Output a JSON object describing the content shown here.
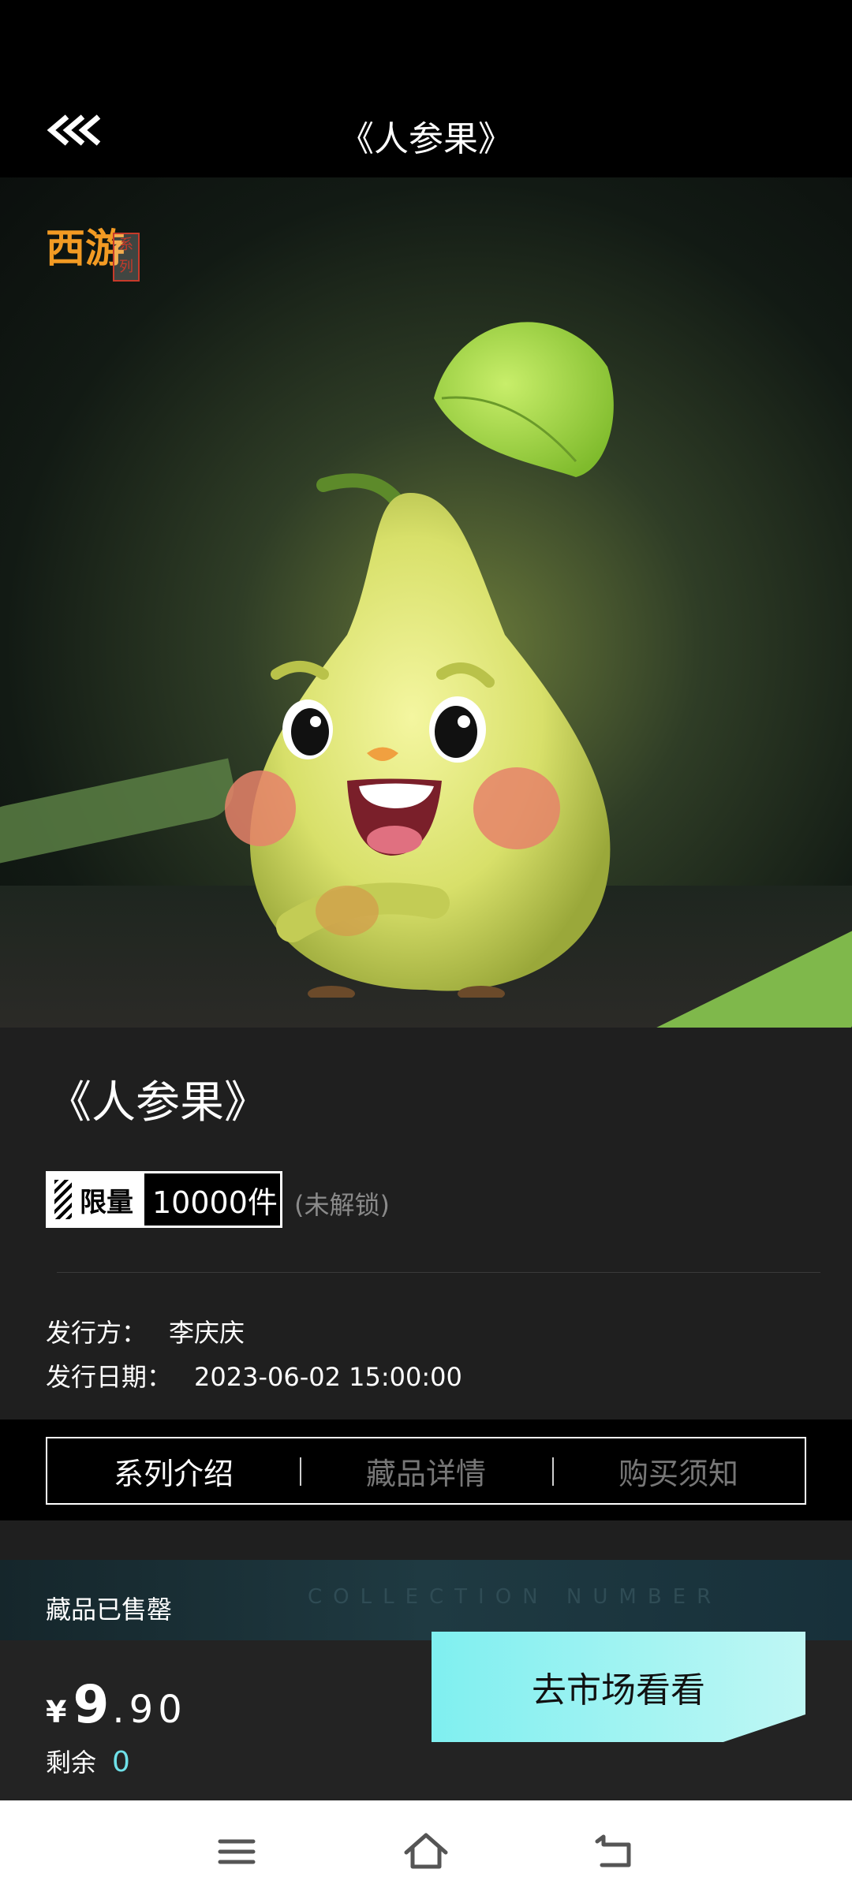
{
  "header": {
    "title": "《人参果》"
  },
  "hero": {
    "logo_text": "西游",
    "logo_seal": "系列"
  },
  "item": {
    "name": "《人参果》",
    "limit_label": "限量",
    "limit_value": "10000件",
    "unlock_status": "(未解锁)",
    "issuer_label": "发行方：",
    "issuer_value": "李庆庆",
    "date_label": "发行日期：",
    "date_value": "2023-06-02 15:00:00"
  },
  "tabs": [
    {
      "label": "系列介绍",
      "active": true
    },
    {
      "label": "藏品详情",
      "active": false
    },
    {
      "label": "购买须知",
      "active": false
    }
  ],
  "purchase": {
    "sold_out_text": "藏品已售罄",
    "watermark": "COLLECTION   NUMBER",
    "currency": "¥",
    "price_int": "9",
    "price_dec": ".90",
    "remain_label": "剩余",
    "remain_value": "0",
    "market_button": "去市场看看"
  },
  "colors": {
    "accent": "#7FEFF0",
    "remain": "#6FE0E8",
    "background": "#1F1F1F"
  }
}
